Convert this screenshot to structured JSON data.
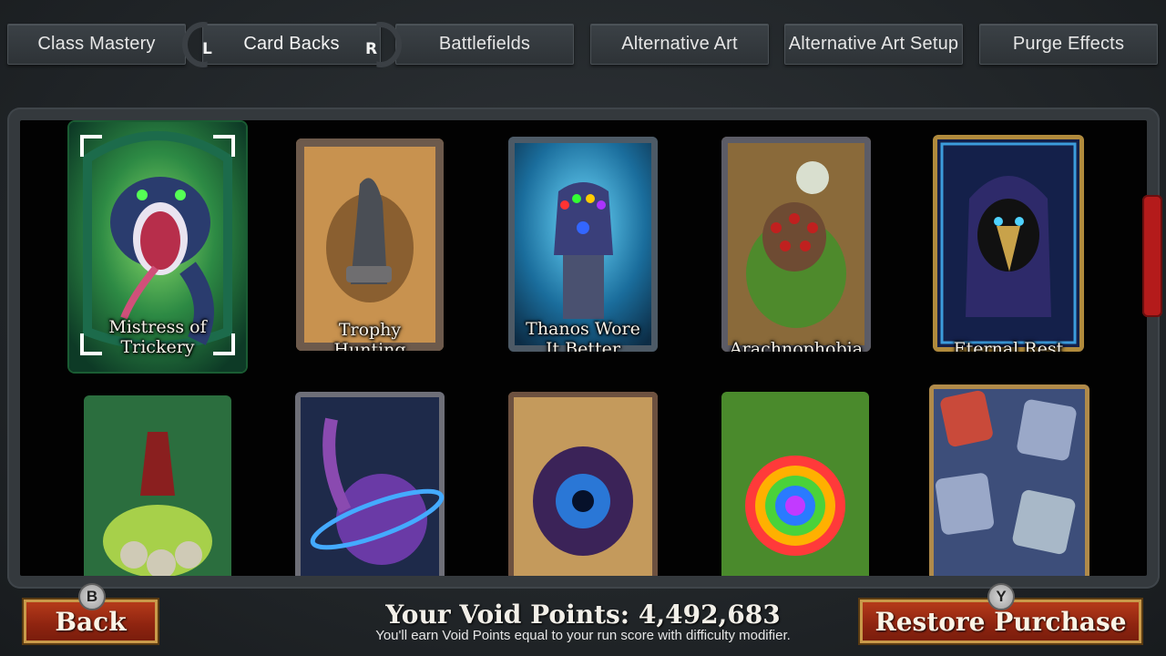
{
  "tabs": [
    {
      "label": "Class Mastery"
    },
    {
      "label": "Card Backs"
    },
    {
      "label": "Battlefields"
    },
    {
      "label": "Alternative Art"
    },
    {
      "label": "Alternative Art Setup"
    },
    {
      "label": "Purge Effects"
    }
  ],
  "bumpers": {
    "left": "L",
    "right": "R"
  },
  "cards": [
    {
      "title_line1": "Mistress of",
      "title_line2": "Trickery"
    },
    {
      "title_line1": "Trophy",
      "title_line2": "Hunting"
    },
    {
      "title_line1": "Thanos Wore",
      "title_line2": "It Better"
    },
    {
      "title_line1": "",
      "title_line2": "Arachnophobia"
    },
    {
      "title_line1": "",
      "title_line2": "Eternal Rest"
    }
  ],
  "footer": {
    "back_badge": "B",
    "back_label": "Back",
    "points_text": "Your Void Points: 4,492,683",
    "hint_text": "You'll earn Void Points equal to your run score with difficulty modifier.",
    "restore_badge": "Y",
    "restore_label": "Restore Purchase"
  },
  "colors": {
    "accent_button": "#8e2410",
    "button_border": "#c99a4a",
    "scrollbar": "#b41b1b",
    "selection": "#1a5c33"
  }
}
